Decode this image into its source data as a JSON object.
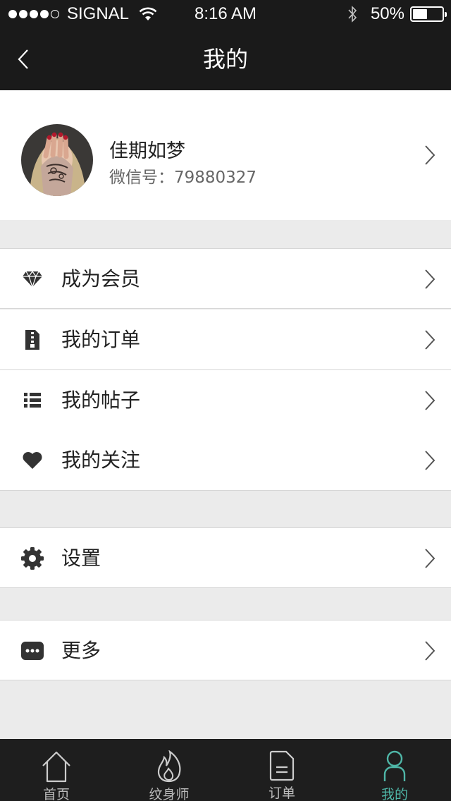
{
  "status_bar": {
    "carrier": "SIGNAL",
    "time": "8:16 AM",
    "battery": "50%",
    "battery_level": 0.5
  },
  "nav": {
    "title": "我的",
    "back_icon": "chevron-left-icon"
  },
  "profile": {
    "name": "佳期如梦",
    "wechat": "微信号：79880327"
  },
  "menu": {
    "membership": "成为会员",
    "orders": "我的订单",
    "posts": "我的帖子",
    "follows": "我的关注",
    "settings": "设置",
    "more": "更多"
  },
  "tabs": [
    {
      "label": "首页",
      "icon": "home-icon"
    },
    {
      "label": "纹身师",
      "icon": "flame-icon"
    },
    {
      "label": "订单",
      "icon": "document-icon"
    },
    {
      "label": "我的",
      "icon": "person-icon"
    }
  ],
  "colors": {
    "bar_bg": "#1a1a1a",
    "accent": "#4fb7a8",
    "page_bg": "#ebebeb"
  }
}
